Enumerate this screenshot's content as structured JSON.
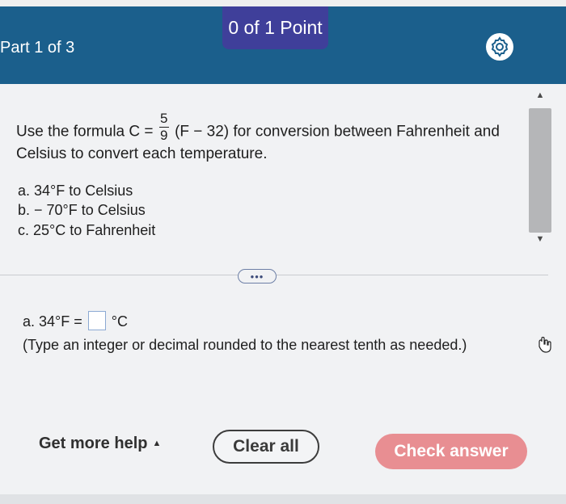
{
  "header": {
    "points": "0 of 1 Point",
    "part": "Part 1 of 3"
  },
  "question": {
    "intro_pre": "Use the formula C =",
    "frac_num": "5",
    "frac_den": "9",
    "intro_post": "(F − 32) for conversion between Fahrenheit and",
    "intro_line2": "Celsius to convert each temperature.",
    "items": [
      "a. 34°F to Celsius",
      "b. − 70°F to Celsius",
      "c. 25°C to Fahrenheit"
    ]
  },
  "answer": {
    "prefix": "a.  34°F =",
    "suffix": "°C",
    "hint": "(Type an integer or decimal rounded to the nearest tenth as needed.)"
  },
  "expander": {
    "label": "•••"
  },
  "buttons": {
    "help": "Get more help",
    "clear": "Clear all",
    "check": "Check answer"
  },
  "colors": {
    "header": "#1b5f8c",
    "badge": "#3f3f9a",
    "check_button": "#e88e92"
  }
}
